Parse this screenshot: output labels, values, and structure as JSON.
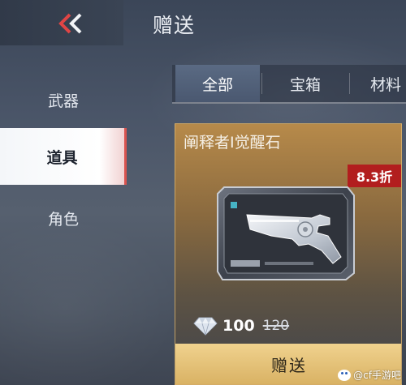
{
  "header": {
    "title": "赠送",
    "back_icon": "double-chevron-left-icon",
    "accent_color": "#d9534f"
  },
  "sidebar": {
    "items": [
      {
        "label": "武器",
        "active": false
      },
      {
        "label": "道具",
        "active": true
      },
      {
        "label": "角色",
        "active": false
      }
    ]
  },
  "tabs": [
    {
      "label": "全部",
      "active": true
    },
    {
      "label": "宝箱",
      "active": false
    },
    {
      "label": "材料",
      "active": false
    }
  ],
  "item_card": {
    "name": "阐释者I觉醒石",
    "discount": "8.3折",
    "discount_color": "#b21e1e",
    "icon": "revolver-awakening-stone-icon",
    "currency_icon": "diamond-icon",
    "price": "100",
    "original_price": "120",
    "gift_button": "赠送",
    "gift_button_color": "#e6c27a"
  },
  "watermark": {
    "text": "@cf手游吧"
  }
}
